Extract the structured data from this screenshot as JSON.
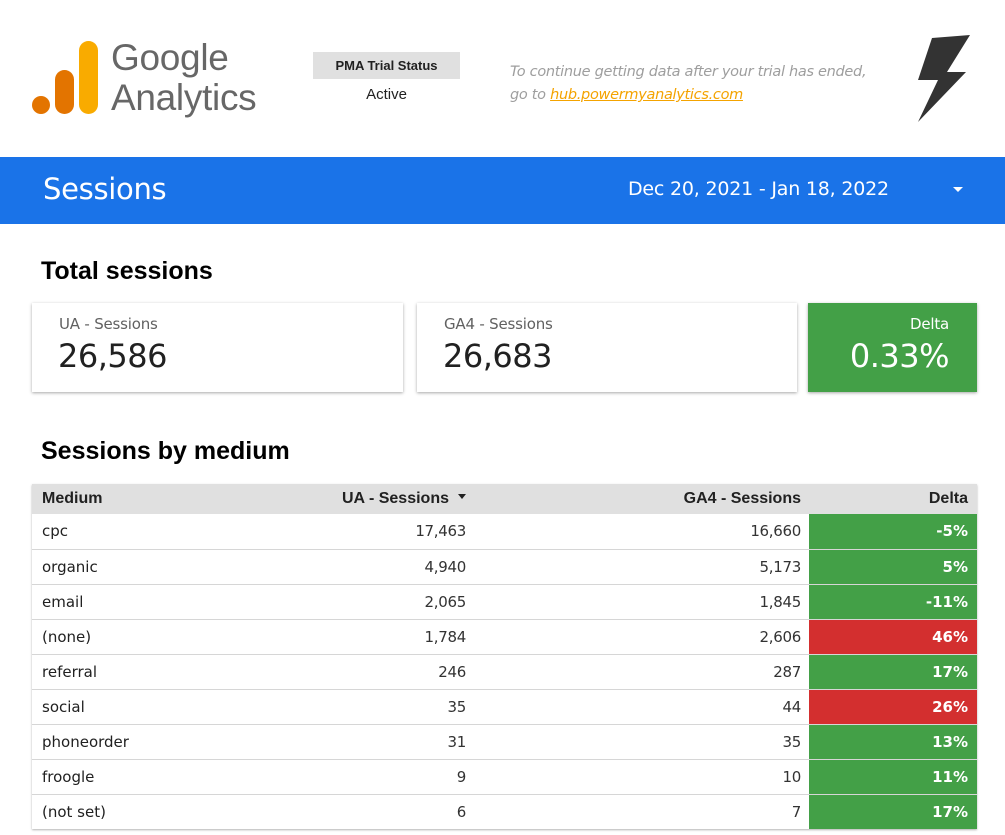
{
  "logo": {
    "line1": "Google",
    "line2": "Analytics",
    "colors": {
      "dot": "#e37400",
      "mid_bar": "#e37400",
      "tall_bar": "#f9ab00"
    }
  },
  "trial": {
    "label": "PMA Trial Status",
    "value": "Active"
  },
  "notice": {
    "line1": "To continue getting data after your trial has ended,",
    "line2_prefix": "go to ",
    "link_text": "hub.powermyanalytics.com"
  },
  "brand_icon": "lightning-bolt-icon",
  "band": {
    "title": "Sessions",
    "date_range": "Dec 20, 2021 - Jan 18, 2022",
    "color": "#1a73e8"
  },
  "totals": {
    "title": "Total sessions",
    "cards": [
      {
        "label": "UA - Sessions",
        "value": "26,586"
      },
      {
        "label": "GA4 - Sessions",
        "value": "26,683"
      },
      {
        "label": "Delta",
        "value": "0.33%"
      }
    ]
  },
  "by_medium": {
    "title": "Sessions by medium",
    "columns": [
      "Medium",
      "UA - Sessions",
      "GA4 - Sessions",
      "Delta"
    ],
    "sorted_column": "UA - Sessions",
    "sort_direction": "descending",
    "status_colors": {
      "good": "#43a047",
      "bad": "#d32f2f"
    },
    "rows": [
      {
        "medium": "cpc",
        "ua": "17,463",
        "ga4": "16,660",
        "delta": "-5%",
        "status": "good"
      },
      {
        "medium": "organic",
        "ua": "4,940",
        "ga4": "5,173",
        "delta": "5%",
        "status": "good"
      },
      {
        "medium": "email",
        "ua": "2,065",
        "ga4": "1,845",
        "delta": "-11%",
        "status": "good"
      },
      {
        "medium": "(none)",
        "ua": "1,784",
        "ga4": "2,606",
        "delta": "46%",
        "status": "bad"
      },
      {
        "medium": "referral",
        "ua": "246",
        "ga4": "287",
        "delta": "17%",
        "status": "good"
      },
      {
        "medium": "social",
        "ua": "35",
        "ga4": "44",
        "delta": "26%",
        "status": "bad"
      },
      {
        "medium": "phoneorder",
        "ua": "31",
        "ga4": "35",
        "delta": "13%",
        "status": "good"
      },
      {
        "medium": "froogle",
        "ua": "9",
        "ga4": "10",
        "delta": "11%",
        "status": "good"
      },
      {
        "medium": "(not set)",
        "ua": "6",
        "ga4": "7",
        "delta": "17%",
        "status": "good"
      }
    ]
  }
}
